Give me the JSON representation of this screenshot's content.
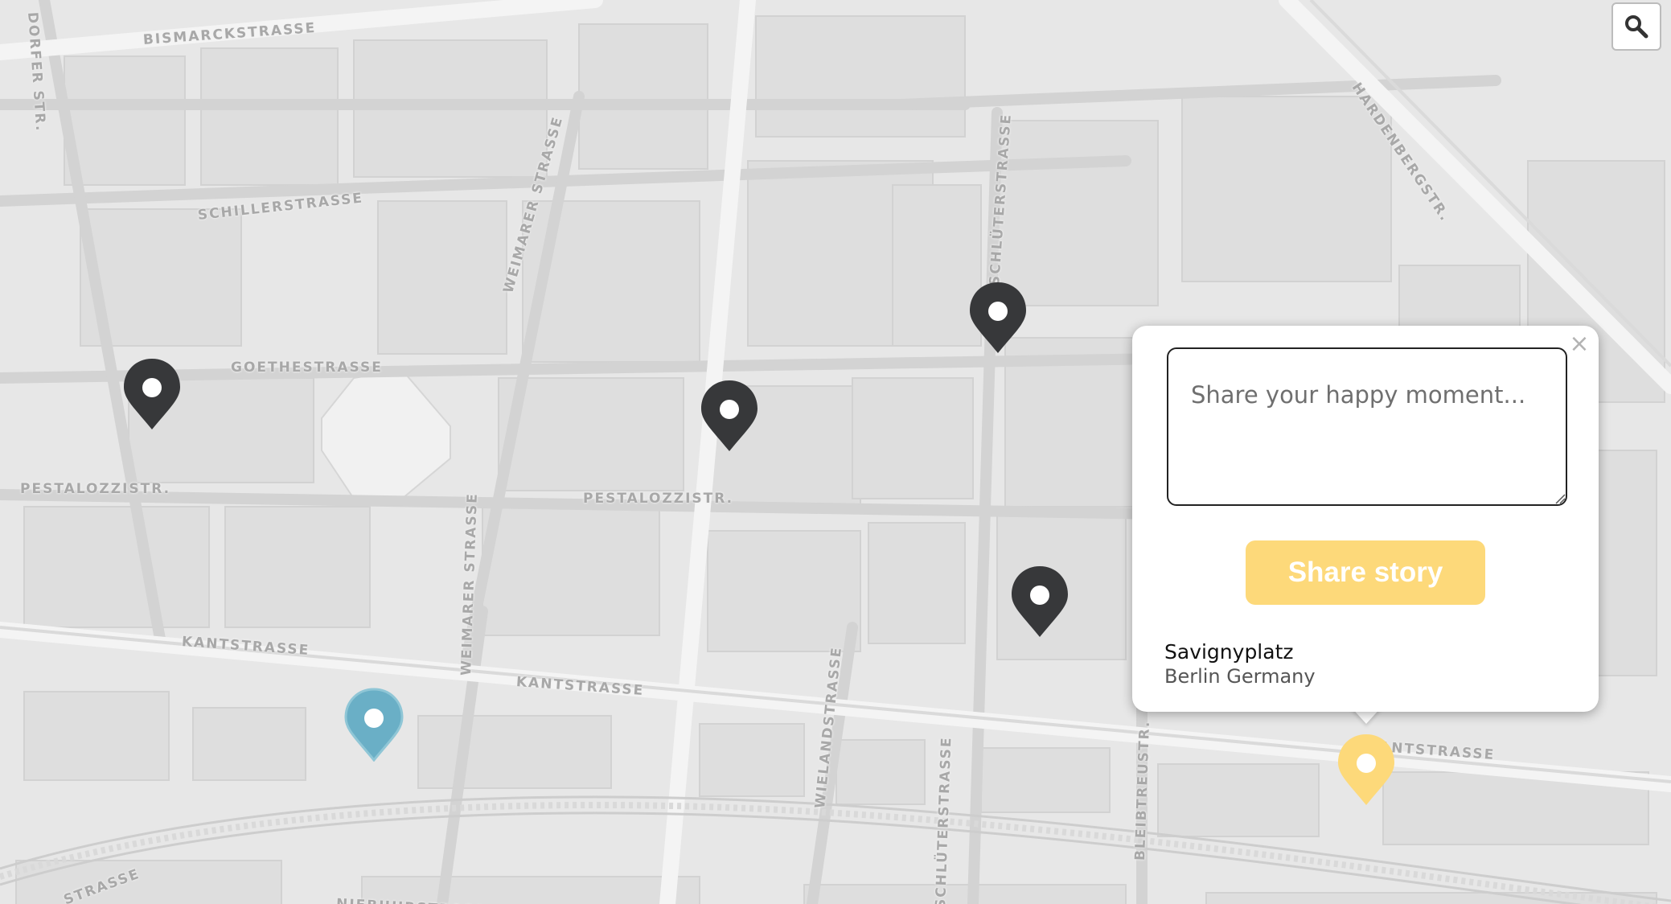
{
  "map": {
    "streets": [
      "BISMARCKSTRASSE",
      "DORFER STR.",
      "SCHILLERSTRASSE",
      "WEIMARER STRASSE",
      "GOETHESTRASSE",
      "PESTALOZZISTR.",
      "PESTALOZZISTR.",
      "SCHLÜTERSTRASSE",
      "HARDENBERGSTR.",
      "KANTSTRASSE",
      "KANTSTRASSE",
      "WEIMARER STRASSE",
      "WIELANDSTRASSE",
      "KANTSTRASSE",
      "BLEIBTREUSTR.",
      "SCHLÜTERSTRASSE",
      "STRASSE",
      "NIEBUHRSTRASSE"
    ],
    "markers": [
      {
        "type": "story",
        "color": "#37383a"
      },
      {
        "type": "story",
        "color": "#37383a"
      },
      {
        "type": "story",
        "color": "#37383a"
      },
      {
        "type": "story",
        "color": "#37383a"
      },
      {
        "type": "current-location",
        "color": "#6aafc6"
      },
      {
        "type": "selected",
        "color": "#fdd97a"
      }
    ]
  },
  "search": {
    "icon": "search-icon"
  },
  "popup": {
    "input_placeholder": "Share your happy moment...",
    "share_label": "Share story",
    "close_glyph": "×",
    "place_name": "Savignyplatz",
    "place_city": "Berlin Germany"
  },
  "colors": {
    "marker_dark": "#37383a",
    "marker_blue": "#6aafc6",
    "marker_yellow": "#fdd97a",
    "button_yellow": "#fdd97a"
  }
}
